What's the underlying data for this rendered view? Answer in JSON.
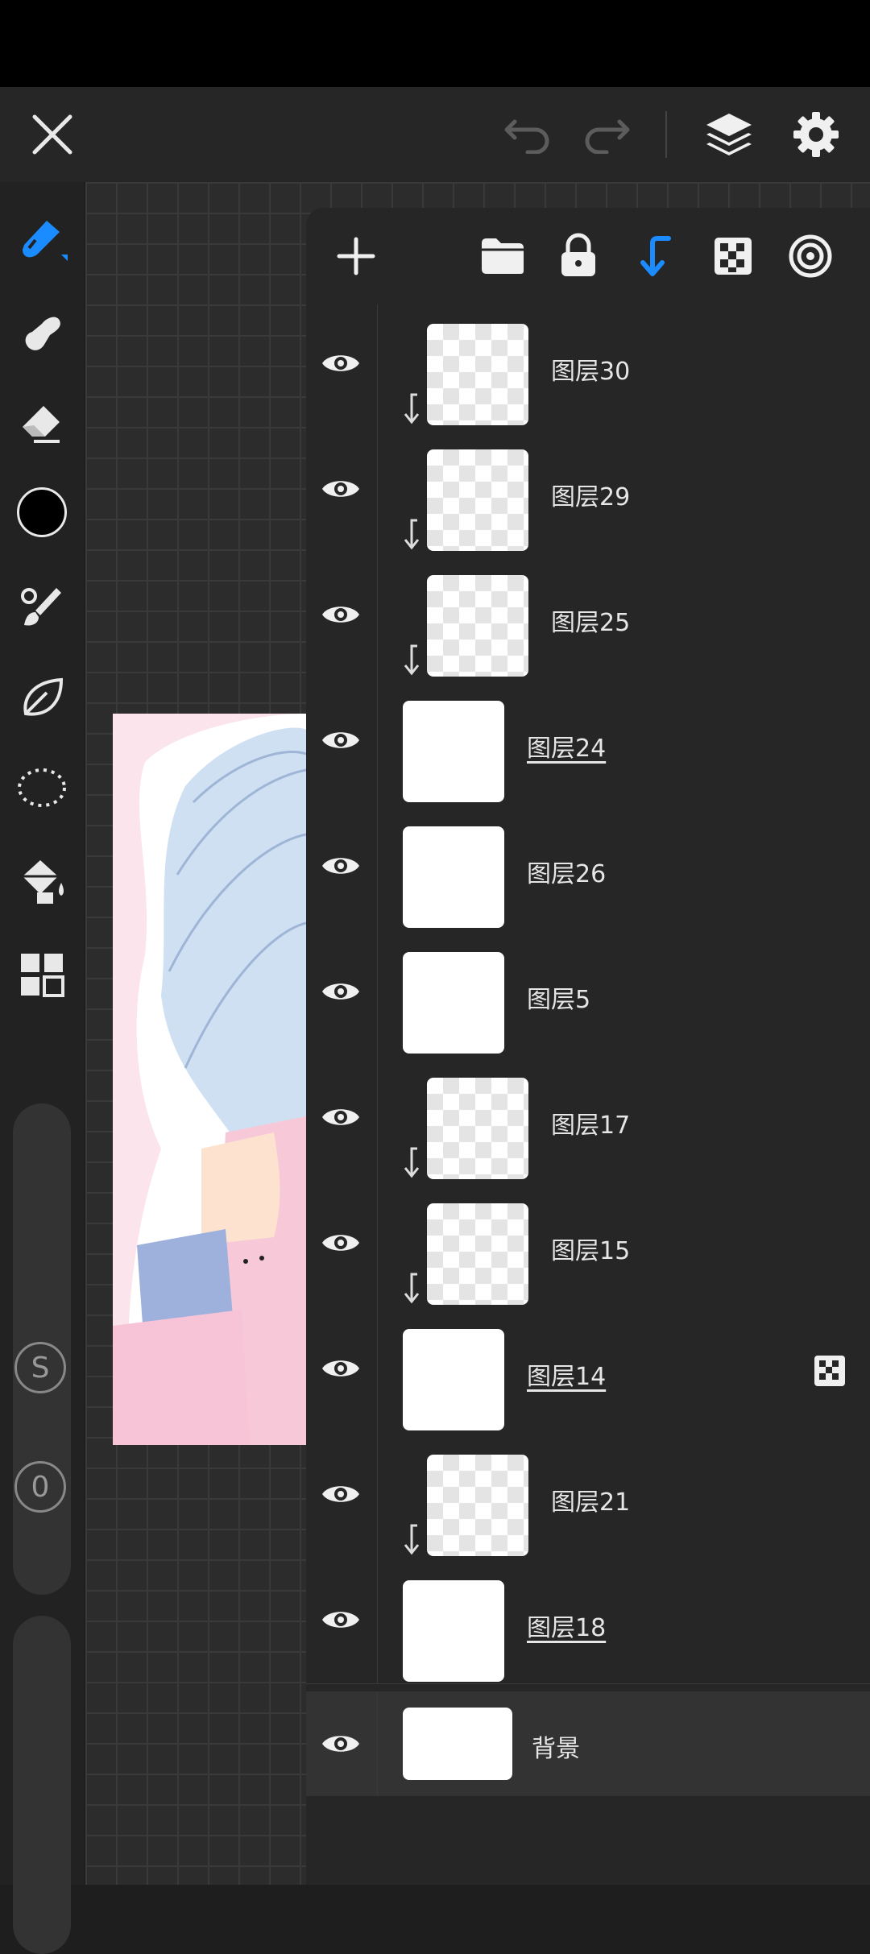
{
  "accent_color": "#1a8cff",
  "toolbar_top": {
    "close_icon": "close-icon",
    "undo_icon": "undo-icon",
    "redo_icon": "redo-icon",
    "layers_icon": "layers-icon",
    "settings_icon": "gear-icon"
  },
  "left_tools": [
    "brush-icon",
    "smudge-icon",
    "eraser-icon",
    "color-swatch",
    "paintbrush-icon",
    "leaf-icon",
    "lasso-icon",
    "fill-bucket-icon",
    "grid-icon"
  ],
  "left_badges": {
    "size_label": "S",
    "opacity_label": "0"
  },
  "layers_panel": {
    "header_icons": [
      "add-icon",
      "folder-icon",
      "lock-icon",
      "clip-icon",
      "alpha-icon",
      "blend-icon"
    ],
    "layers": [
      {
        "name": "图层30",
        "clipped": true
      },
      {
        "name": "图层29",
        "clipped": true
      },
      {
        "name": "图层25",
        "clipped": true
      },
      {
        "name": "图层24",
        "clipped": false,
        "underline": true
      },
      {
        "name": "图层26",
        "clipped": false
      },
      {
        "name": "图层5",
        "clipped": false
      },
      {
        "name": "图层17",
        "clipped": true
      },
      {
        "name": "图层15",
        "clipped": true
      },
      {
        "name": "图层14",
        "clipped": false,
        "underline": true,
        "alpha_lock": true
      },
      {
        "name": "图层21",
        "clipped": true
      },
      {
        "name": "图层18",
        "clipped": false,
        "underline": true
      },
      {
        "name": "背景",
        "clipped": false,
        "background": true
      }
    ]
  }
}
